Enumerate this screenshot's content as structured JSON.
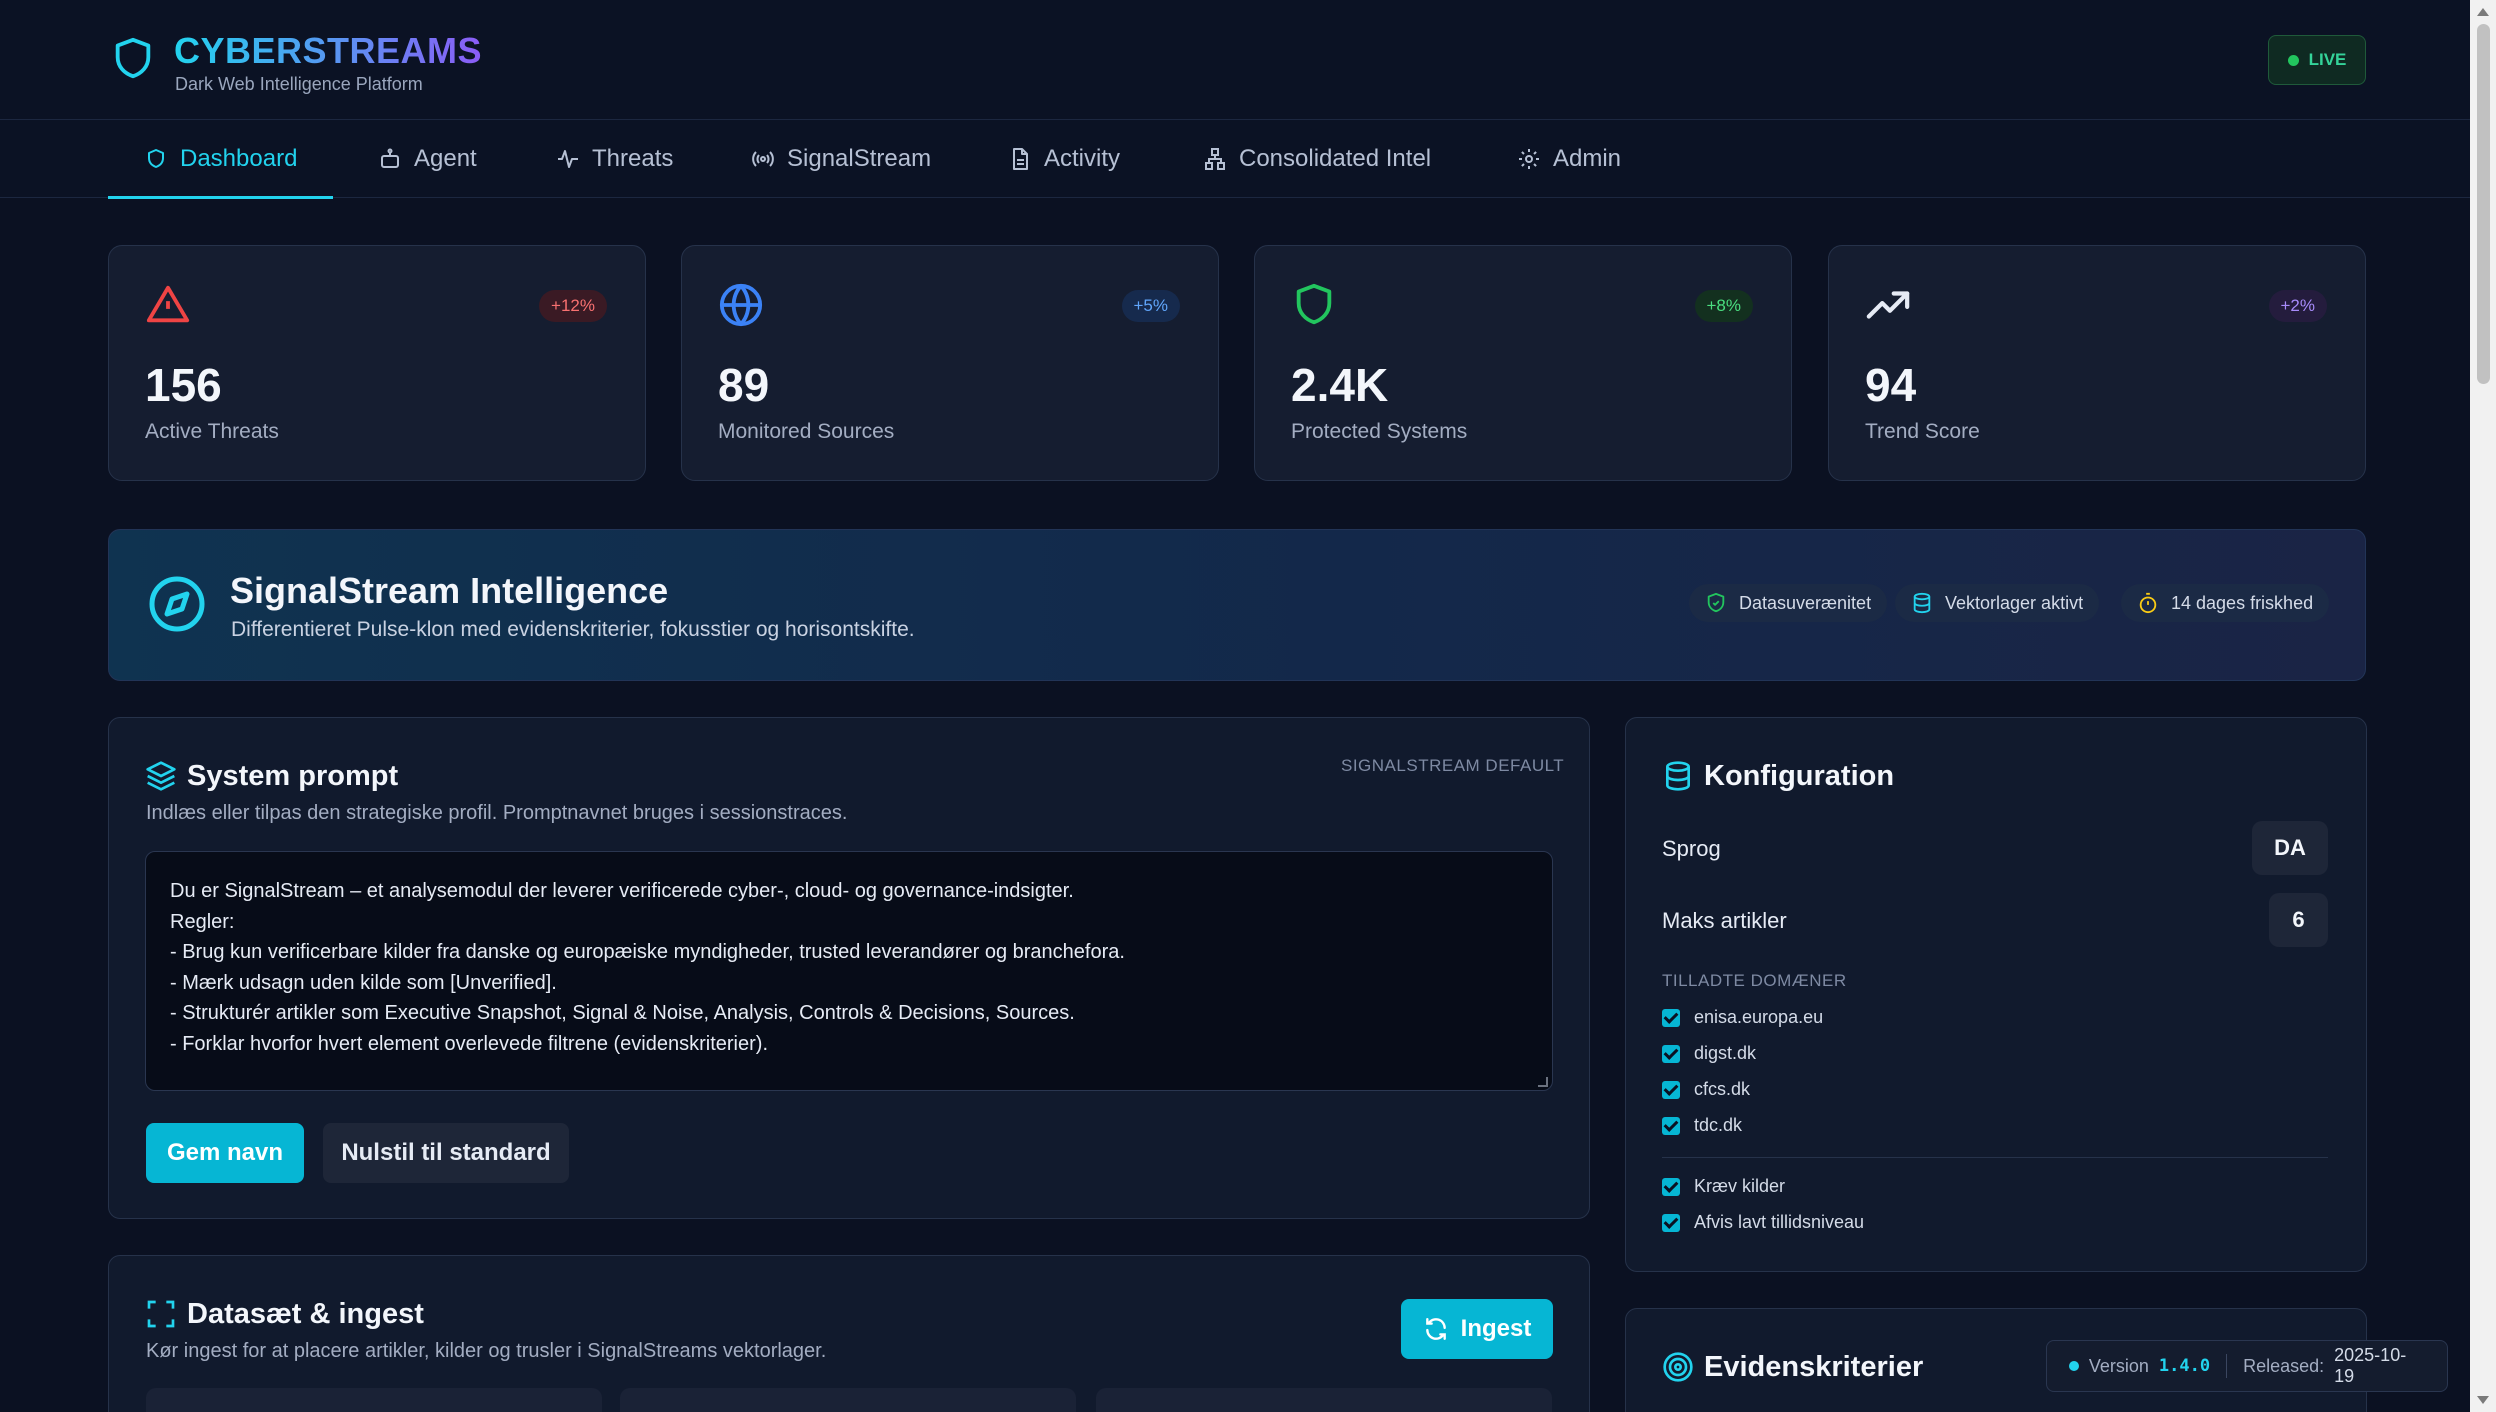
{
  "header": {
    "brand": "CYBERSTREAMS",
    "subtitle": "Dark Web Intelligence Platform",
    "live_label": "LIVE"
  },
  "nav": {
    "tabs": [
      {
        "label": "Dashboard",
        "icon": "shield-icon",
        "active": true
      },
      {
        "label": "Agent",
        "icon": "robot-icon"
      },
      {
        "label": "Threats",
        "icon": "activity-icon"
      },
      {
        "label": "SignalStream",
        "icon": "radio-icon"
      },
      {
        "label": "Activity",
        "icon": "file-icon"
      },
      {
        "label": "Consolidated Intel",
        "icon": "network-icon"
      },
      {
        "label": "Admin",
        "icon": "gear-icon"
      }
    ]
  },
  "stats": [
    {
      "value": "156",
      "label": "Active Threats",
      "change": "+12%",
      "icon": "alert-triangle-icon",
      "color": "#ef4444"
    },
    {
      "value": "89",
      "label": "Monitored Sources",
      "change": "+5%",
      "icon": "globe-icon",
      "color": "#3b82f6"
    },
    {
      "value": "2.4K",
      "label": "Protected Systems",
      "change": "+8%",
      "icon": "shield-icon",
      "color": "#22c55e"
    },
    {
      "value": "94",
      "label": "Trend Score",
      "change": "+2%",
      "icon": "trending-up-icon",
      "color": "#a855f7"
    }
  ],
  "banner": {
    "title": "SignalStream Intelligence",
    "subtitle": "Differentieret Pulse-klon med evidenskriterier, fokusstier og horisontskifte.",
    "chips": [
      {
        "label": "Datasuverænitet",
        "icon": "shield-check-icon"
      },
      {
        "label": "Vektorlager aktivt",
        "icon": "database-icon"
      },
      {
        "label": "14 dages friskhed",
        "icon": "timer-icon"
      }
    ]
  },
  "system_prompt": {
    "title": "System prompt",
    "tag": "SIGNALSTREAM DEFAULT",
    "subtitle": "Indlæs eller tilpas den strategiske profil. Promptnavnet bruges i sessionstraces.",
    "text": "Du er SignalStream – et analysemodul der leverer verificerede cyber-, cloud- og governance-indsigter.\nRegler:\n- Brug kun verificerbare kilder fra danske og europæiske myndigheder, trusted leverandører og branchefora.\n- Mærk udsagn uden kilde som [Unverified].\n- Strukturér artikler som Executive Snapshot, Signal & Noise, Analysis, Controls & Decisions, Sources.\n- Forklar hvorfor hvert element overlevede filtrene (evidenskriterier).",
    "save_label": "Gem navn",
    "reset_label": "Nulstil til standard"
  },
  "dataset": {
    "title": "Datasæt & ingest",
    "subtitle": "Kør ingest for at placere artikler, kilder og trusler i SignalStreams vektorlager.",
    "ingest_label": "Ingest"
  },
  "config": {
    "title": "Konfiguration",
    "language_label": "Sprog",
    "language_value": "DA",
    "max_articles_label": "Maks artikler",
    "max_articles_value": "6",
    "domains_label": "TILLADTE DOMÆNER",
    "domains": [
      "enisa.europa.eu",
      "digst.dk",
      "cfcs.dk",
      "tdc.dk"
    ],
    "options": [
      "Kræv kilder",
      "Afvis lavt tillidsniveau"
    ]
  },
  "evidence": {
    "title": "Evidenskriterier"
  },
  "version": {
    "label": "Version",
    "number": "1.4.0",
    "released_label": "Released:",
    "released_date": "2025-10-19"
  },
  "colors": {
    "accent": "#22d3ee",
    "background": "#0b1122",
    "card": "#151d30"
  }
}
